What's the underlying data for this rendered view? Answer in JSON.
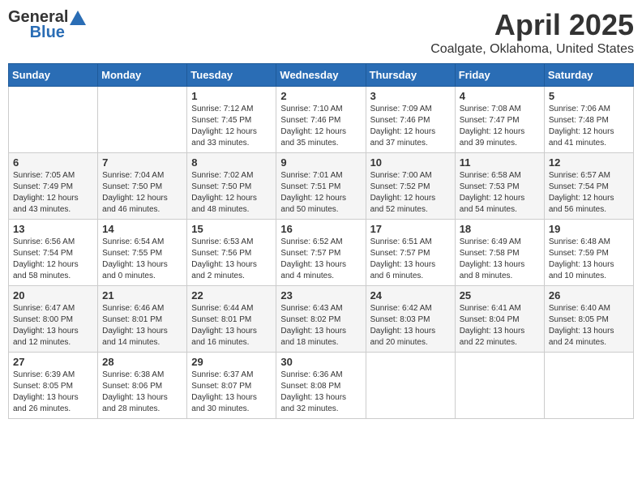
{
  "header": {
    "logo_general": "General",
    "logo_blue": "Blue",
    "title": "April 2025",
    "location": "Coalgate, Oklahoma, United States"
  },
  "weekdays": [
    "Sunday",
    "Monday",
    "Tuesday",
    "Wednesday",
    "Thursday",
    "Friday",
    "Saturday"
  ],
  "weeks": [
    [
      {
        "day": "",
        "info": ""
      },
      {
        "day": "",
        "info": ""
      },
      {
        "day": "1",
        "info": "Sunrise: 7:12 AM\nSunset: 7:45 PM\nDaylight: 12 hours\nand 33 minutes."
      },
      {
        "day": "2",
        "info": "Sunrise: 7:10 AM\nSunset: 7:46 PM\nDaylight: 12 hours\nand 35 minutes."
      },
      {
        "day": "3",
        "info": "Sunrise: 7:09 AM\nSunset: 7:46 PM\nDaylight: 12 hours\nand 37 minutes."
      },
      {
        "day": "4",
        "info": "Sunrise: 7:08 AM\nSunset: 7:47 PM\nDaylight: 12 hours\nand 39 minutes."
      },
      {
        "day": "5",
        "info": "Sunrise: 7:06 AM\nSunset: 7:48 PM\nDaylight: 12 hours\nand 41 minutes."
      }
    ],
    [
      {
        "day": "6",
        "info": "Sunrise: 7:05 AM\nSunset: 7:49 PM\nDaylight: 12 hours\nand 43 minutes."
      },
      {
        "day": "7",
        "info": "Sunrise: 7:04 AM\nSunset: 7:50 PM\nDaylight: 12 hours\nand 46 minutes."
      },
      {
        "day": "8",
        "info": "Sunrise: 7:02 AM\nSunset: 7:50 PM\nDaylight: 12 hours\nand 48 minutes."
      },
      {
        "day": "9",
        "info": "Sunrise: 7:01 AM\nSunset: 7:51 PM\nDaylight: 12 hours\nand 50 minutes."
      },
      {
        "day": "10",
        "info": "Sunrise: 7:00 AM\nSunset: 7:52 PM\nDaylight: 12 hours\nand 52 minutes."
      },
      {
        "day": "11",
        "info": "Sunrise: 6:58 AM\nSunset: 7:53 PM\nDaylight: 12 hours\nand 54 minutes."
      },
      {
        "day": "12",
        "info": "Sunrise: 6:57 AM\nSunset: 7:54 PM\nDaylight: 12 hours\nand 56 minutes."
      }
    ],
    [
      {
        "day": "13",
        "info": "Sunrise: 6:56 AM\nSunset: 7:54 PM\nDaylight: 12 hours\nand 58 minutes."
      },
      {
        "day": "14",
        "info": "Sunrise: 6:54 AM\nSunset: 7:55 PM\nDaylight: 13 hours\nand 0 minutes."
      },
      {
        "day": "15",
        "info": "Sunrise: 6:53 AM\nSunset: 7:56 PM\nDaylight: 13 hours\nand 2 minutes."
      },
      {
        "day": "16",
        "info": "Sunrise: 6:52 AM\nSunset: 7:57 PM\nDaylight: 13 hours\nand 4 minutes."
      },
      {
        "day": "17",
        "info": "Sunrise: 6:51 AM\nSunset: 7:57 PM\nDaylight: 13 hours\nand 6 minutes."
      },
      {
        "day": "18",
        "info": "Sunrise: 6:49 AM\nSunset: 7:58 PM\nDaylight: 13 hours\nand 8 minutes."
      },
      {
        "day": "19",
        "info": "Sunrise: 6:48 AM\nSunset: 7:59 PM\nDaylight: 13 hours\nand 10 minutes."
      }
    ],
    [
      {
        "day": "20",
        "info": "Sunrise: 6:47 AM\nSunset: 8:00 PM\nDaylight: 13 hours\nand 12 minutes."
      },
      {
        "day": "21",
        "info": "Sunrise: 6:46 AM\nSunset: 8:01 PM\nDaylight: 13 hours\nand 14 minutes."
      },
      {
        "day": "22",
        "info": "Sunrise: 6:44 AM\nSunset: 8:01 PM\nDaylight: 13 hours\nand 16 minutes."
      },
      {
        "day": "23",
        "info": "Sunrise: 6:43 AM\nSunset: 8:02 PM\nDaylight: 13 hours\nand 18 minutes."
      },
      {
        "day": "24",
        "info": "Sunrise: 6:42 AM\nSunset: 8:03 PM\nDaylight: 13 hours\nand 20 minutes."
      },
      {
        "day": "25",
        "info": "Sunrise: 6:41 AM\nSunset: 8:04 PM\nDaylight: 13 hours\nand 22 minutes."
      },
      {
        "day": "26",
        "info": "Sunrise: 6:40 AM\nSunset: 8:05 PM\nDaylight: 13 hours\nand 24 minutes."
      }
    ],
    [
      {
        "day": "27",
        "info": "Sunrise: 6:39 AM\nSunset: 8:05 PM\nDaylight: 13 hours\nand 26 minutes."
      },
      {
        "day": "28",
        "info": "Sunrise: 6:38 AM\nSunset: 8:06 PM\nDaylight: 13 hours\nand 28 minutes."
      },
      {
        "day": "29",
        "info": "Sunrise: 6:37 AM\nSunset: 8:07 PM\nDaylight: 13 hours\nand 30 minutes."
      },
      {
        "day": "30",
        "info": "Sunrise: 6:36 AM\nSunset: 8:08 PM\nDaylight: 13 hours\nand 32 minutes."
      },
      {
        "day": "",
        "info": ""
      },
      {
        "day": "",
        "info": ""
      },
      {
        "day": "",
        "info": ""
      }
    ]
  ]
}
